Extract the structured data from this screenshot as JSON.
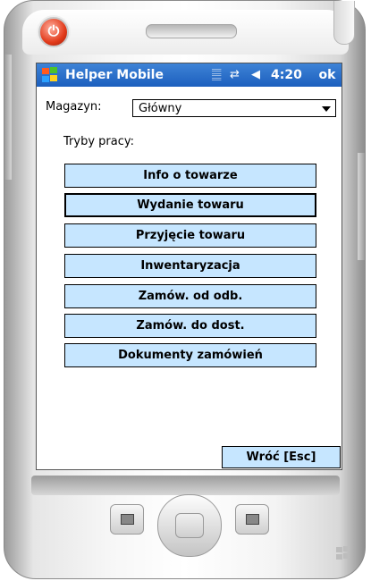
{
  "taskbar": {
    "title": "Helper Mobile",
    "time": "4:20",
    "ok": "ok",
    "icons": [
      "antenna-icon",
      "sync-icon",
      "speaker-icon"
    ]
  },
  "warehouse": {
    "label": "Magazyn:",
    "value": "Główny"
  },
  "modes": {
    "label": "Tryby pracy:",
    "buttons": [
      "Info o towarze",
      "Wydanie towaru",
      "Przyjęcie towaru",
      "Inwentaryzacja",
      "Zamów. od odb.",
      "Zamów. do dost.",
      "Dokumenty zamówień"
    ],
    "focused": "Wydanie towaru"
  },
  "back": {
    "label": "Wróć [Esc]"
  },
  "colors": {
    "taskbar": "#1c5fbe",
    "button": "#c6e6ff",
    "power": "#e23a1a"
  }
}
